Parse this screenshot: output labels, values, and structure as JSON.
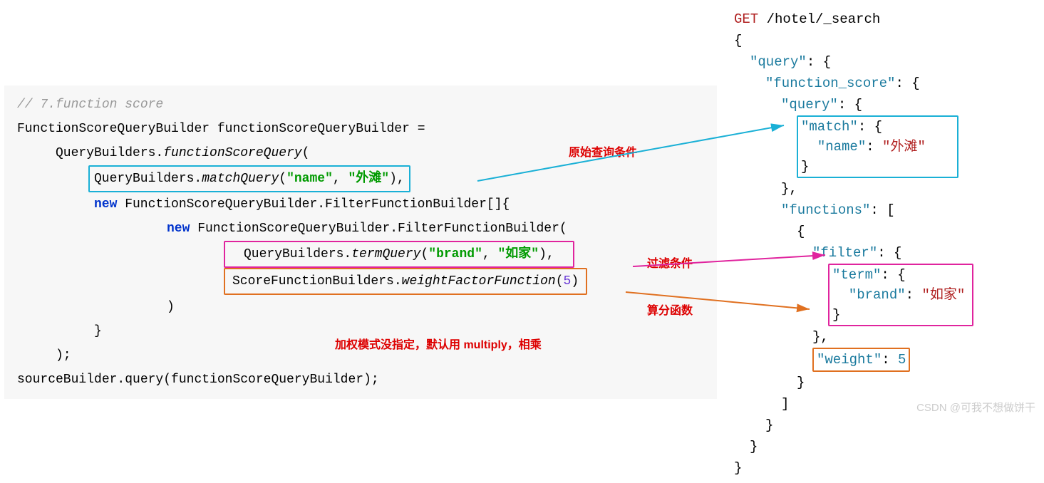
{
  "java": {
    "comment": "// 7.function score",
    "line1": "FunctionScoreQueryBuilder functionScoreQueryBuilder =",
    "line2_prefix": "QueryBuilders.",
    "line2_method": "functionScoreQuery",
    "line2_suffix": "(",
    "match_prefix": "QueryBuilders.",
    "match_method": "matchQuery",
    "match_open": "(",
    "match_arg1": "\"name\"",
    "match_comma": ", ",
    "match_arg2": "\"外滩\"",
    "match_close": "),",
    "line4_kw": "new",
    "line4_rest": " FunctionScoreQueryBuilder.FilterFunctionBuilder[]{",
    "line5_kw": "new",
    "line5_rest": " FunctionScoreQueryBuilder.FilterFunctionBuilder(",
    "term_prefix": "QueryBuilders.",
    "term_method": "termQuery",
    "term_open": "(",
    "term_arg1": "\"brand\"",
    "term_comma": ", ",
    "term_arg2": "\"如家\"",
    "term_close": "),",
    "weight_prefix": "ScoreFunctionBuilders.",
    "weight_method": "weightFactorFunction",
    "weight_open": "(",
    "weight_arg": "5",
    "weight_close": ")",
    "close_paren": ")",
    "close_brace": "}",
    "end_paren": ");",
    "final_line": "sourceBuilder.query(functionScoreQueryBuilder);"
  },
  "annotations": {
    "original_query": "原始查询条件",
    "filter": "过滤条件",
    "score_fn": "算分函数",
    "boost_mode": "加权模式没指定，默认用 multiply，相乘"
  },
  "json": {
    "get": "GET",
    "path": " /hotel/_search",
    "open1": "{",
    "k_query": "\"query\"",
    "k_function_score": "\"function_score\"",
    "k_query2": "\"query\"",
    "k_match": "\"match\"",
    "k_name": "\"name\"",
    "v_name": "\"外滩\"",
    "k_functions": "\"functions\"",
    "k_filter": "\"filter\"",
    "k_term": "\"term\"",
    "k_brand": "\"brand\"",
    "v_brand": "\"如家\"",
    "k_weight": "\"weight\"",
    "v_weight": "5"
  },
  "watermark": "CSDN @可我不想做饼干"
}
